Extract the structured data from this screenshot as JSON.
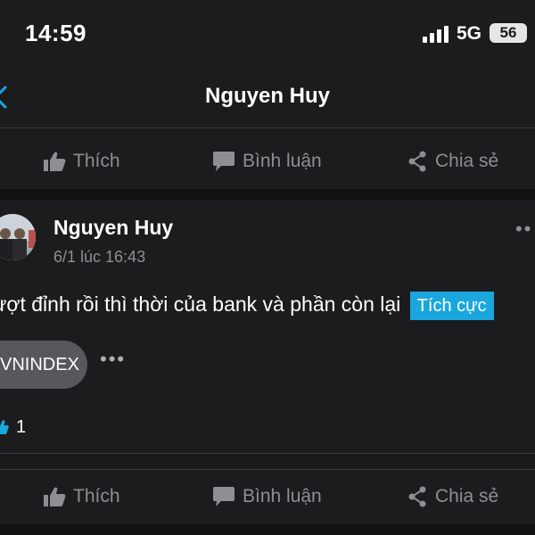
{
  "status_bar": {
    "time": "14:59",
    "network": "5G",
    "battery": "56"
  },
  "nav": {
    "title": "Nguyen Huy",
    "back_icon": "chevron-left-icon"
  },
  "shared_action_bar": {
    "like": "Thích",
    "comment": "Bình luận",
    "share": "Chia sẻ"
  },
  "post": {
    "author": "Nguyen Huy",
    "time": "6/1 lúc 16:43",
    "text": "ượt đỉnh rồi thì thời của bank và phần còn lại",
    "sentiment_tag": "Tích cực",
    "ticker": "VNINDEX",
    "reaction_count": "1",
    "actions": {
      "like": "Thích",
      "comment": "Bình luận",
      "share": "Chia sẻ"
    }
  },
  "colors": {
    "background": "#1c1c1e",
    "accent": "#1aa7dd",
    "muted_text": "#8e8e93",
    "chip": "#58585c"
  }
}
